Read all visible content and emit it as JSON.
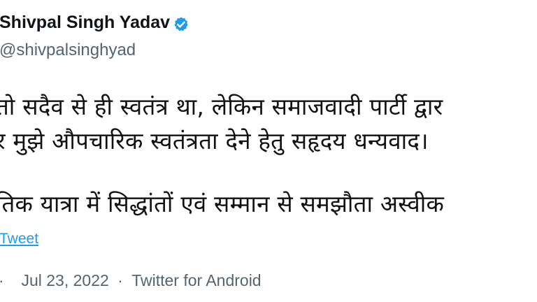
{
  "author": {
    "name": "Shivpal Singh Yadav",
    "handle": "@shivpalsinghyad",
    "verified_color": "#1d9bf0"
  },
  "tweet": {
    "lines": [
      "तो सदैव से ही स्वतंत्र था, लेकिन समाजवादी पार्टी द्वार",
      "र मुझे औपचारिक स्वतंत्रता देने हेतु सहृदय धन्यवाद।",
      "तिक यात्रा में सिद्धांतों एवं सम्मान से समझौता अस्वीक"
    ],
    "translate_label": "Tweet"
  },
  "meta": {
    "time_fragment": "·",
    "separator": "·",
    "date": "Jul 23, 2022",
    "source": "Twitter for Android"
  },
  "icons": {
    "verified": "verified-badge-icon"
  }
}
